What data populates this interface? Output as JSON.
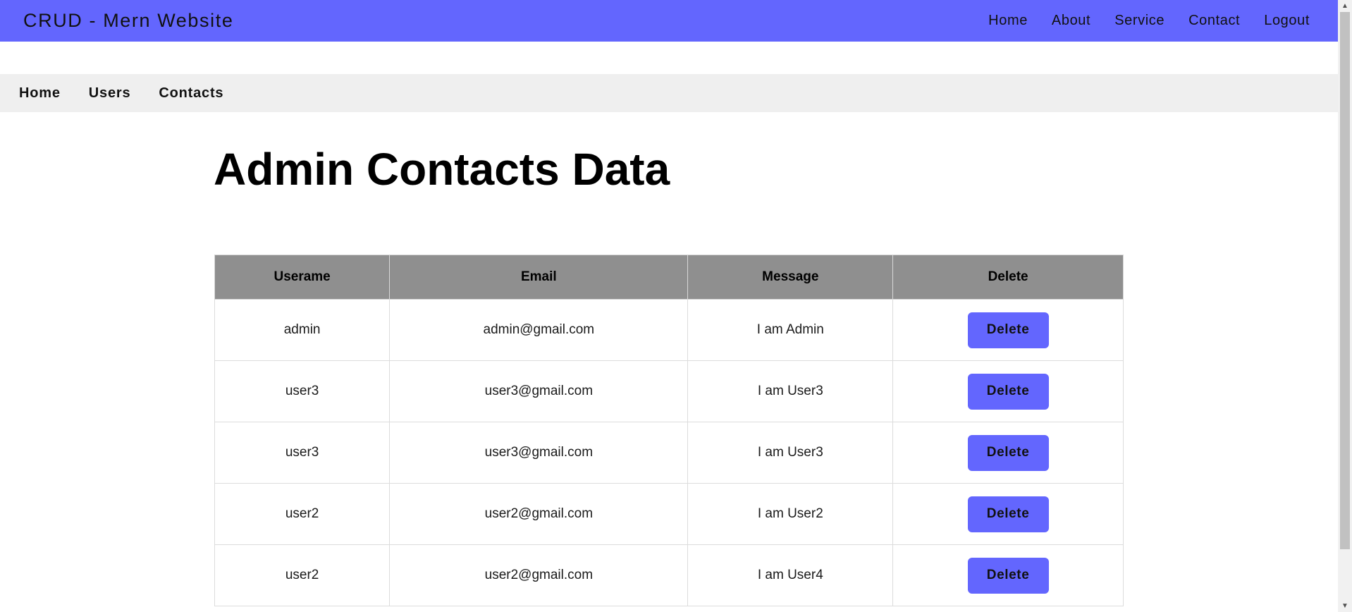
{
  "header": {
    "brand": "CRUD - Mern Website",
    "nav": [
      "Home",
      "About",
      "Service",
      "Contact",
      "Logout"
    ]
  },
  "admin_nav": [
    "Home",
    "Users",
    "Contacts"
  ],
  "page_title": "Admin Contacts Data",
  "table": {
    "columns": [
      "Userame",
      "Email",
      "Message",
      "Delete"
    ],
    "rows": [
      {
        "username": "admin",
        "email": "admin@gmail.com",
        "message": "I am Admin",
        "action": "Delete"
      },
      {
        "username": "user3",
        "email": "user3@gmail.com",
        "message": "I am User3",
        "action": "Delete"
      },
      {
        "username": "user3",
        "email": "user3@gmail.com",
        "message": "I am User3",
        "action": "Delete"
      },
      {
        "username": "user2",
        "email": "user2@gmail.com",
        "message": "I am User2",
        "action": "Delete"
      },
      {
        "username": "user2",
        "email": "user2@gmail.com",
        "message": "I am User4",
        "action": "Delete"
      }
    ]
  },
  "colors": {
    "accent": "#6366fe",
    "table_header": "#8f8f8f",
    "subnav_bg": "#efefef"
  },
  "icons": {
    "scroll_up": "scroll-up-arrow-icon",
    "scroll_down": "scroll-down-arrow-icon"
  }
}
